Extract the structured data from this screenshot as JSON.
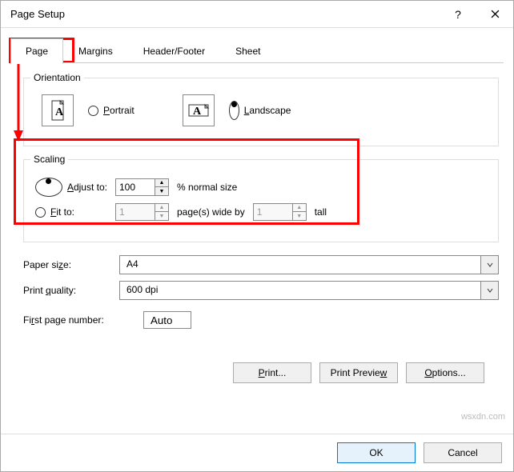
{
  "titlebar": {
    "title": "Page Setup"
  },
  "tabs": {
    "page": "Page",
    "margins": "Margins",
    "headerfooter": "Header/Footer",
    "sheet": "Sheet"
  },
  "orientation": {
    "legend": "Orientation",
    "portrait": "Portrait",
    "landscape": "Landscape",
    "selected": "landscape"
  },
  "scaling": {
    "legend": "Scaling",
    "adjust_label": "Adjust to:",
    "adjust_value": "100",
    "adjust_suffix": "% normal size",
    "fit_label": "Fit to:",
    "fit_wide": "1",
    "fit_mid": "page(s) wide by",
    "fit_tall_val": "1",
    "fit_tall": "tall",
    "selected": "adjust"
  },
  "paper": {
    "label": "Paper size:",
    "value": "A4"
  },
  "quality": {
    "label": "Print quality:",
    "value": "600 dpi"
  },
  "firstpage": {
    "label": "First page number:",
    "value": "Auto"
  },
  "buttons": {
    "print": "Print...",
    "preview": "Print Preview",
    "options": "Options..."
  },
  "footer": {
    "ok": "OK",
    "cancel": "Cancel"
  },
  "watermark": "wsxdn.com"
}
